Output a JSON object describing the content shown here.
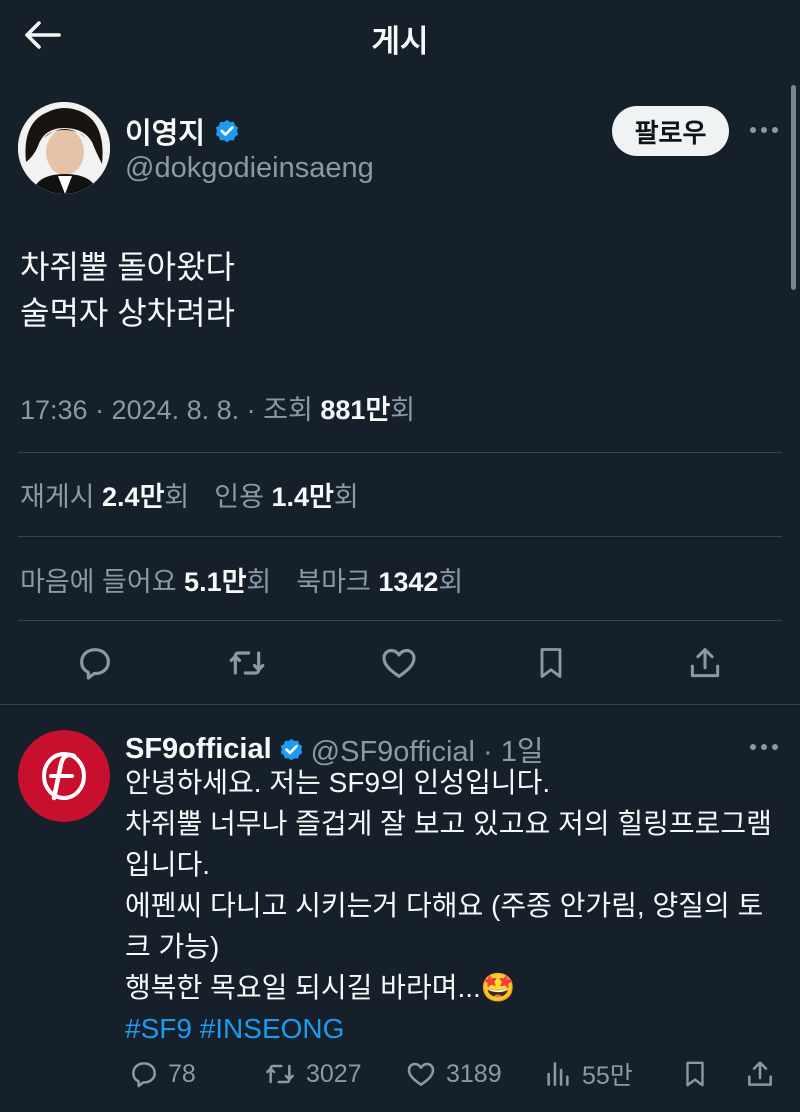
{
  "header": {
    "title": "게시"
  },
  "author": {
    "name": "이영지",
    "handle": "@dokgodieinsaeng",
    "follow_label": "팔로우",
    "verified_color": "#1d9bf0"
  },
  "tweet": {
    "lines": [
      "차쥐뿔 돌아왔다",
      "술먹자 상차려라"
    ],
    "meta_prefix": "17:36 · 2024. 8. 8. · 조회 ",
    "views": "881만",
    "views_suffix": "회"
  },
  "stats": {
    "reposts_label": "재게시 ",
    "reposts": "2.4만",
    "reposts_suffix": "회",
    "quotes_label": "인용 ",
    "quotes": "1.4만",
    "quotes_suffix": "회",
    "likes_label": "마음에 들어요 ",
    "likes": "5.1만",
    "likes_suffix": "회",
    "bookmarks_label": "북마크 ",
    "bookmarks": "1342",
    "bookmarks_suffix": "회"
  },
  "actions": [
    "reply-icon",
    "repost-icon",
    "like-icon",
    "bookmark-icon",
    "share-icon"
  ],
  "reply": {
    "name": "SF9official",
    "handle_time": "@SF9official · 1일",
    "lines": [
      "안녕하세요. 저는 SF9의 인성입니다.",
      "차쥐뿔 너무나 즐겁게 잘 보고 있고요 저의 힐링프로그램",
      "입니다.",
      "에펜씨 다니고 시키는거 다해요 (주종 안가림, 양질의 토",
      "크 가능)",
      "행복한 목요일 되시길 바라며..."
    ],
    "emoji": "🤩",
    "hashtags": "#SF9 #INSEONG",
    "counts": {
      "replies": "78",
      "reposts": "3027",
      "likes": "3189",
      "views": "55만"
    }
  },
  "colors": {
    "background": "#15202b",
    "text": "#f7f9f9",
    "secondary": "#8b98a5",
    "accent": "#1d9bf0",
    "sf9_red": "#c8102e"
  }
}
